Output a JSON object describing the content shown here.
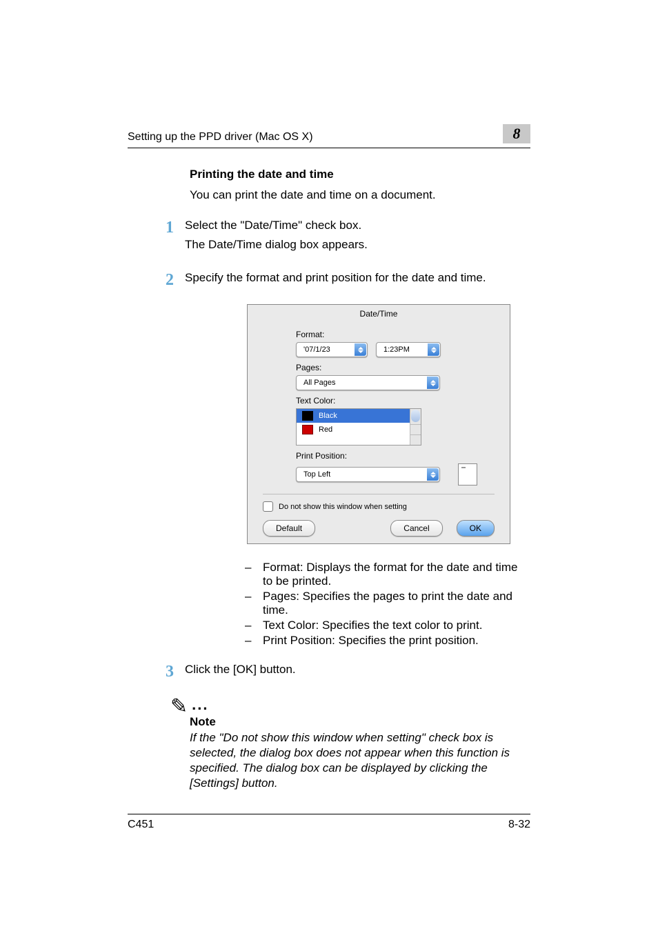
{
  "header": {
    "running": "Setting up the PPD driver (Mac OS X)",
    "chapno": "8"
  },
  "section": {
    "title": "Printing the date and time",
    "intro": "You can print the date and time on a document.",
    "steps": [
      {
        "num": "1",
        "lines": [
          "Select the \"Date/Time\" check box.",
          "The Date/Time dialog box appears."
        ]
      },
      {
        "num": "2",
        "lines": [
          "Specify the format and print position for the date and time."
        ]
      },
      {
        "num": "3",
        "lines": [
          "Click the [OK] button."
        ]
      }
    ]
  },
  "dialog": {
    "title": "Date/Time",
    "format_label": "Format:",
    "format_date": "'07/1/23",
    "format_time": "1:23PM",
    "pages_label": "Pages:",
    "pages_value": "All Pages",
    "textcolor_label": "Text Color:",
    "colors": [
      {
        "name": "Black",
        "hex": "#000000",
        "selected": true
      },
      {
        "name": "Red",
        "hex": "#cc0000",
        "selected": false
      }
    ],
    "printpos_label": "Print Position:",
    "printpos_value": "Top Left",
    "dontshow": "Do not show this window when setting",
    "buttons": {
      "default": "Default",
      "cancel": "Cancel",
      "ok": "OK"
    }
  },
  "bullets": [
    "Format: Displays the format for the date and time to be printed.",
    "Pages: Specifies the pages to print the date and time.",
    "Text Color: Specifies the text color to print.",
    "Print Position: Specifies the print position."
  ],
  "note": {
    "label": "Note",
    "body": "If the \"Do not show this window when setting\" check box is selected, the dialog box does not appear when this function is specified. The dialog box can be displayed by clicking the [Settings] button."
  },
  "footer": {
    "left": "C451",
    "right": "8-32"
  }
}
